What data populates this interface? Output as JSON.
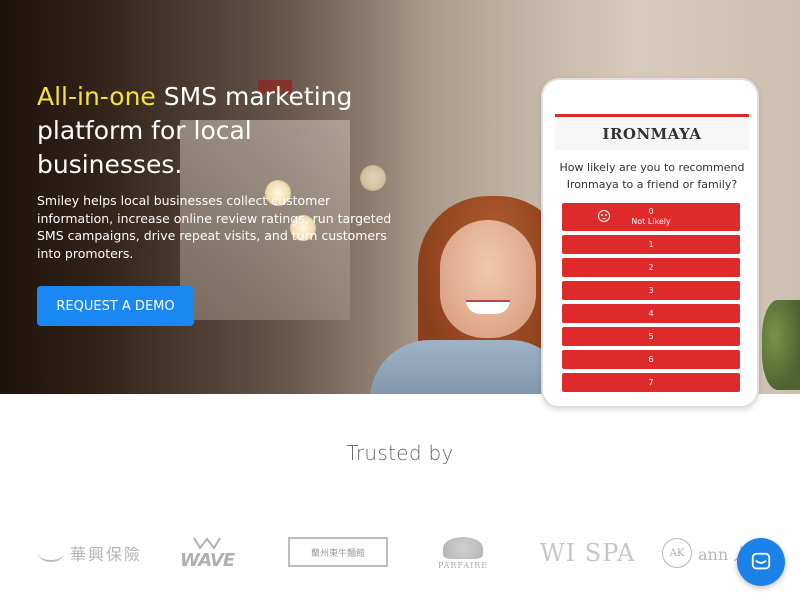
{
  "hero": {
    "headline_accent": "All-in-one",
    "headline_rest": " SMS marketing platform for local businesses.",
    "description": "Smiley helps local businesses collect customer information, increase online review ratings, run targeted SMS campaigns, drive repeat visits, and turn customers into promoters.",
    "cta_label": "REQUEST A DEMO"
  },
  "phone": {
    "brand": "IRONMAYA",
    "question": "How likely are you to recommend Ironmaya to a friend or family?",
    "first_option_value": "0",
    "first_option_caption": "Not Likely",
    "options": [
      "1",
      "2",
      "3",
      "4",
      "5",
      "6",
      "7"
    ]
  },
  "trusted": {
    "heading": "Trusted by",
    "logos": {
      "logo1": "華興保險",
      "logo2": "WAVE",
      "logo3": "蘭州東牛麵館",
      "logo4": "PARFAIRE",
      "logo5": "WI SPA",
      "logo6": "ann 人"
    }
  },
  "colors": {
    "accent_yellow": "#f5e33a",
    "cta_blue": "#1a88f2",
    "option_red": "#de2a2a",
    "chat_blue": "#1b82e8"
  },
  "icons": {
    "chat": "chat-bubble-icon",
    "sad_face": "sad-face-icon"
  }
}
